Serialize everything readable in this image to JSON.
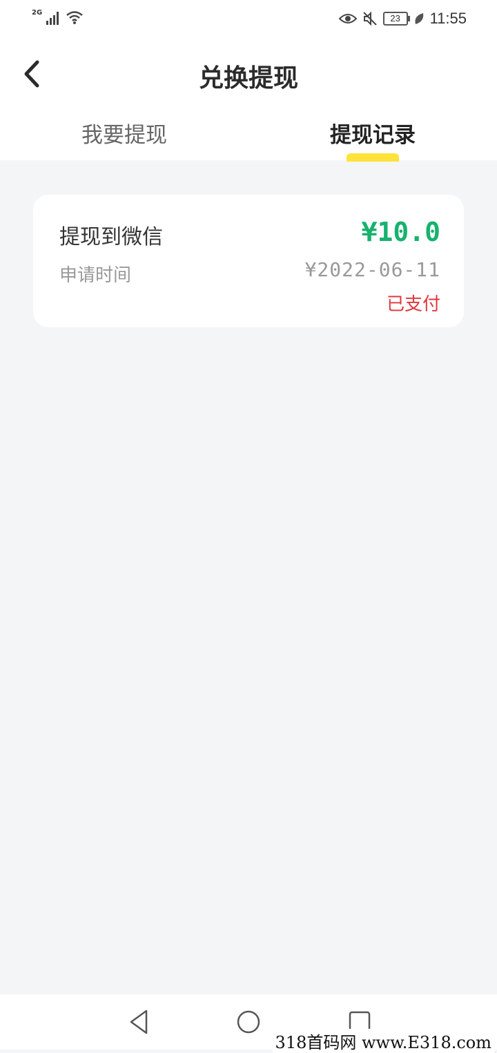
{
  "status_bar": {
    "network": "2G",
    "battery": "23",
    "time": "11:55"
  },
  "header": {
    "title": "兑换提现",
    "tabs": [
      {
        "label": "我要提现",
        "active": false
      },
      {
        "label": "提现记录",
        "active": true
      }
    ]
  },
  "records": [
    {
      "title": "提现到微信",
      "amount": "¥10.0",
      "time_label": "申请时间",
      "date": "¥2022-06-11",
      "status": "已支付"
    }
  ],
  "watermark": "318首码网 www.E318.com",
  "colors": {
    "amount": "#17b26e",
    "status": "#e0363c",
    "tab_indicator": "#ffe23a",
    "background": "#f4f5f7"
  },
  "icons": [
    "signal-icon",
    "wifi-icon",
    "eye-icon",
    "mute-icon",
    "battery-icon",
    "leaf-icon",
    "back-arrow-icon",
    "nav-back-icon",
    "nav-home-icon",
    "nav-recent-icon"
  ]
}
